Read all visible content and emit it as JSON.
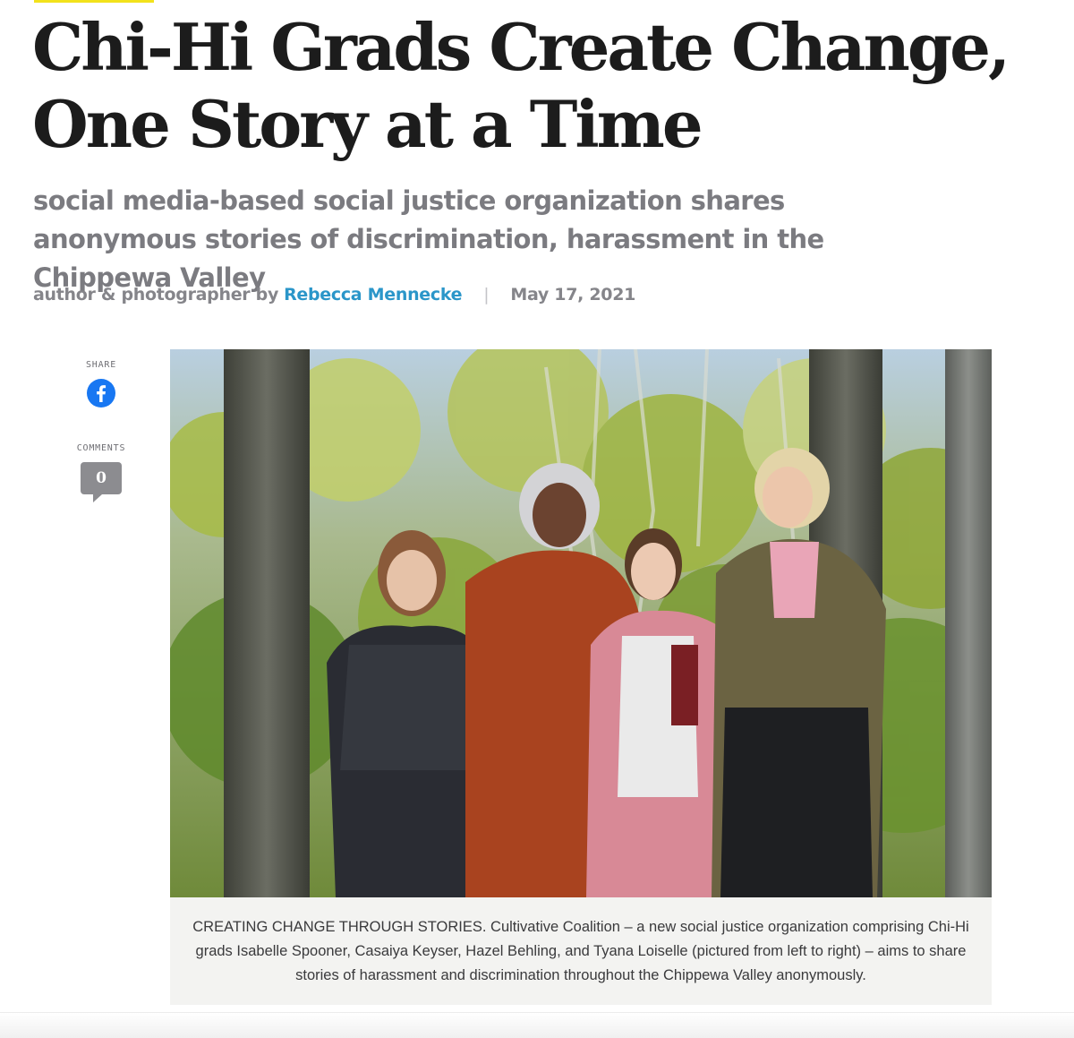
{
  "article": {
    "headline": "Chi-Hi Grads Create Change, One Story at a Time",
    "subheadline": "social media-based social justice organization shares anonymous stories of discrimination, harassment in the Chippewa Valley",
    "byline": {
      "prefix": "author & photographer by",
      "author": "Rebecca Mennecke",
      "separator": "|",
      "date": "May 17, 2021"
    }
  },
  "share_rail": {
    "share_label": "SHARE",
    "share_icon": "facebook-icon",
    "comments_label": "COMMENTS",
    "comments_count": "0"
  },
  "photo": {
    "caption": "CREATING CHANGE THROUGH STORIES. Cultivative Coalition – a new social justice organization comprising Chi-Hi grads Isabelle Spooner, Casaiya Keyser, Hazel Behling, and Tyana Loiselle (pictured from left to right) – aims to share stories of harassment and discrimination throughout the Chippewa Valley anonymously."
  },
  "colors": {
    "accent": "#f2e21c",
    "link": "#2b96c9",
    "facebook": "#1877f2",
    "headline": "#1c1c1c",
    "muted": "#7b7b80"
  }
}
